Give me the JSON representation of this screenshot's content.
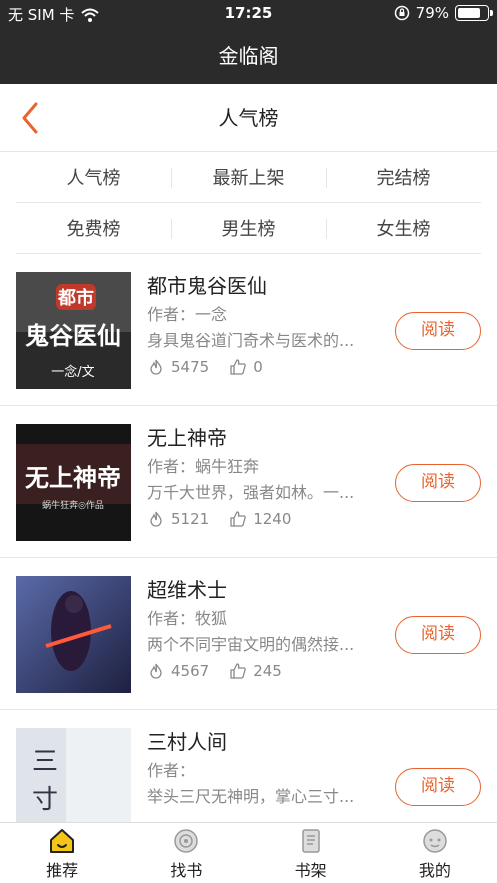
{
  "status": {
    "carrier": "无 SIM 卡",
    "time": "17:25",
    "battery": "79%",
    "battery_level": 0.79
  },
  "app": {
    "title": "金临阁"
  },
  "nav": {
    "title": "人气榜"
  },
  "categories": [
    [
      "人气榜",
      "最新上架",
      "完结榜"
    ],
    [
      "免费榜",
      "男生榜",
      "女生榜"
    ]
  ],
  "books": [
    {
      "title": "都市鬼谷医仙",
      "author": "作者：一念",
      "desc": "身具鬼谷道门奇术与医术的...",
      "hot": "5475",
      "likes": "0",
      "read_label": "阅读",
      "cover": {
        "lines": [
          "都市",
          "鬼谷医仙",
          "一念/文"
        ],
        "bg": "#3a3a3a"
      }
    },
    {
      "title": "无上神帝",
      "author": "作者：蜗牛狂奔",
      "desc": "万千大世界，强者如林。一...",
      "hot": "5121",
      "likes": "1240",
      "read_label": "阅读",
      "cover": {
        "lines": [
          "无上神帝",
          "蜗牛狂奔◎作品"
        ],
        "bg": "#1a1a1a"
      }
    },
    {
      "title": "超维术士",
      "author": "作者：牧狐",
      "desc": "两个不同宇宙文明的偶然接...",
      "hot": "4567",
      "likes": "245",
      "read_label": "阅读",
      "cover": {
        "lines": [],
        "bg": "#3b3f6e"
      }
    },
    {
      "title": "三村人间",
      "author": "作者：",
      "desc": "举头三尺无神明，掌心三寸...",
      "hot": "",
      "likes": "",
      "read_label": "阅读",
      "cover": {
        "lines": [
          "三",
          "寸"
        ],
        "bg": "#dfe4ea"
      }
    }
  ],
  "tabs": [
    {
      "label": "推荐",
      "icon": "home-icon",
      "active": true
    },
    {
      "label": "找书",
      "icon": "compass-icon",
      "active": false
    },
    {
      "label": "书架",
      "icon": "book-icon",
      "active": false
    },
    {
      "label": "我的",
      "icon": "profile-icon",
      "active": false
    }
  ],
  "colors": {
    "accent": "#e8632e",
    "dark_bar": "#2b2b2b",
    "active_tab": "#f5c518"
  }
}
